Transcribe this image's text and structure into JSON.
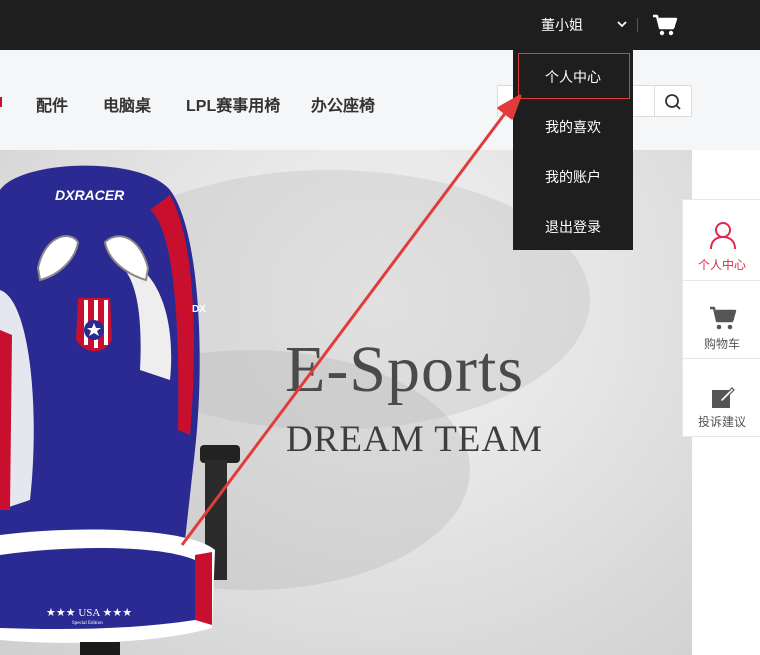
{
  "header": {
    "username": "董小姐",
    "icons": [
      "chevron-down-icon",
      "cart-icon"
    ]
  },
  "nav": {
    "items": [
      "配件",
      "电脑桌",
      "LPL赛事用椅",
      "办公座椅"
    ],
    "search_icon": "search-icon"
  },
  "user_menu": {
    "items": [
      "个人中心",
      "我的喜欢",
      "我的账户",
      "退出登录"
    ],
    "highlighted": "个人中心"
  },
  "banner": {
    "headline": "E-Sports",
    "subline": "DREAM TEAM",
    "chair_logo": "DXRACER",
    "chair_badge": "DX",
    "chair_seat_text": "★★★ USA ★★★",
    "chair_seat_small": "Special Edition"
  },
  "sidebar": {
    "items": [
      {
        "label": "个人中心",
        "icon": "user-icon",
        "active": true
      },
      {
        "label": "购物车",
        "icon": "cart-icon",
        "active": false
      },
      {
        "label": "投诉建议",
        "icon": "edit-icon",
        "active": false
      }
    ]
  },
  "colors": {
    "topbar": "#1e1e1e",
    "accent": "#e0284a",
    "annotation": "#e23b3b"
  }
}
